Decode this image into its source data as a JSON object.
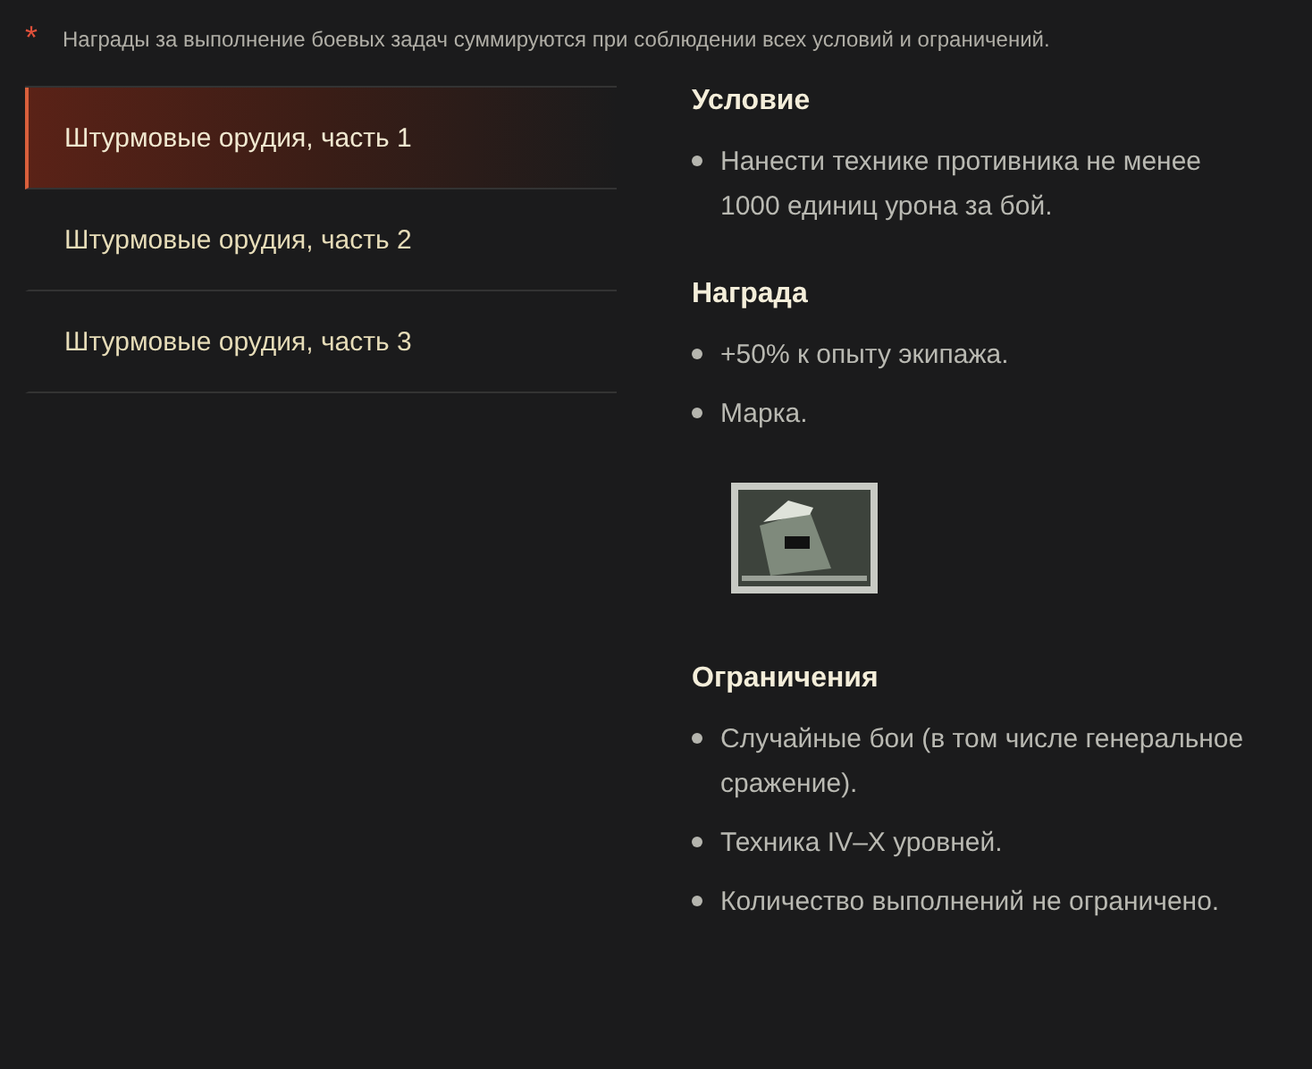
{
  "note": {
    "mark": "*",
    "text": "Награды за выполнение боевых задач суммируются при соблюдении всех условий и ограничений."
  },
  "tabs": [
    {
      "label": "Штурмовые орудия, часть 1",
      "selected": true
    },
    {
      "label": "Штурмовые орудия, часть 2",
      "selected": false
    },
    {
      "label": "Штурмовые орудия, часть 3",
      "selected": false
    }
  ],
  "sections": [
    {
      "title": "Условие",
      "items": [
        "Нанести технике противника не менее 1000 единиц урона за бой."
      ],
      "stamp": false
    },
    {
      "title": "Награда",
      "items": [
        "+50% к опыту экипажа.",
        "Марка."
      ],
      "stamp": true
    },
    {
      "title": "Ограничения",
      "items": [
        "Случайные бои (в том числе генеральное сражение).",
        "Техника IV–X уровней.",
        "Количество выполнений не ограничено."
      ],
      "stamp": false
    }
  ]
}
